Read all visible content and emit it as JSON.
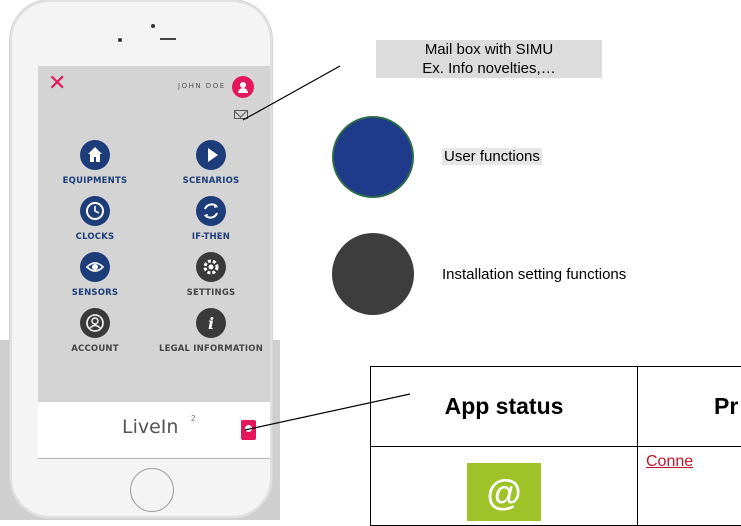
{
  "phone": {
    "user_name": "JOHN DOE",
    "menu": [
      {
        "label": "EQUIPMENTS",
        "icon": "home-icon",
        "type": "user"
      },
      {
        "label": "SCENARIOS",
        "icon": "play-icon",
        "type": "user"
      },
      {
        "label": "CLOCKS",
        "icon": "clock-icon",
        "type": "user"
      },
      {
        "label": "IF-THEN",
        "icon": "cycle-icon",
        "type": "installation"
      },
      {
        "label": "SENSORS",
        "icon": "eye-icon",
        "type": "user"
      },
      {
        "label": "SETTINGS",
        "icon": "gear-icon",
        "type": "installation"
      },
      {
        "label": "ACCOUNT",
        "icon": "account-icon",
        "type": "installation"
      },
      {
        "label": "LEGAL INFORMATION",
        "icon": "info-icon",
        "type": "installation"
      }
    ],
    "logo": {
      "main": "LiveIn",
      "sup": "2"
    },
    "colors": {
      "accent": "#e4175c",
      "user": "#1c3d7a",
      "installation": "#3a3a3a"
    }
  },
  "annotations": {
    "mailbox_line1": "Mail box with SIMU",
    "mailbox_line2": "Ex. Info novelties,…",
    "user_functions": "User functions",
    "installation_functions": "Installation setting functions"
  },
  "table": {
    "headers": [
      "App status",
      "Pr"
    ],
    "row": {
      "status_icon": "@",
      "link_text": "Conne"
    }
  }
}
